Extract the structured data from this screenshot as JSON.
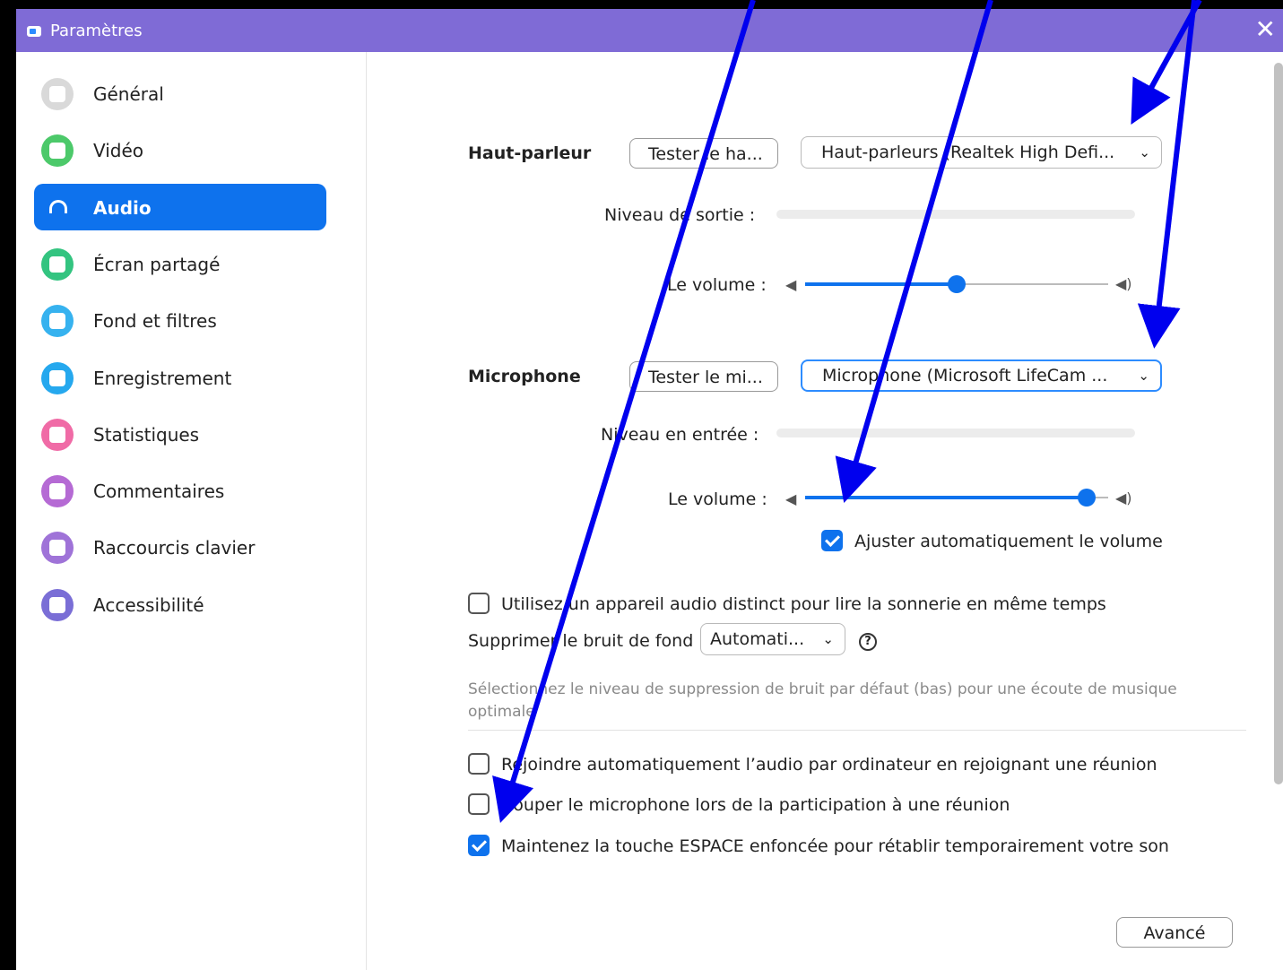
{
  "window": {
    "title": "Paramètres",
    "close": "✕"
  },
  "sidebar": {
    "items": [
      {
        "label": "Général",
        "icon": "gear-icon",
        "color": "#d9d9d9",
        "active": false
      },
      {
        "label": "Vidéo",
        "icon": "video-camera-icon",
        "color": "#4cc96a",
        "active": false
      },
      {
        "label": "Audio",
        "icon": "headphones-icon",
        "color": "#0e72ed",
        "active": true
      },
      {
        "label": "Écran partagé",
        "icon": "share-screen-icon",
        "color": "#33c480",
        "active": false
      },
      {
        "label": "Fond et filtres",
        "icon": "background-filter-icon",
        "color": "#36b2ef",
        "active": false
      },
      {
        "label": "Enregistrement",
        "icon": "record-icon",
        "color": "#25a8ee",
        "active": false
      },
      {
        "label": "Statistiques",
        "icon": "statistics-icon",
        "color": "#f06ba6",
        "active": false
      },
      {
        "label": "Commentaires",
        "icon": "feedback-icon",
        "color": "#b56ad4",
        "active": false
      },
      {
        "label": "Raccourcis clavier",
        "icon": "keyboard-icon",
        "color": "#9f73d8",
        "active": false
      },
      {
        "label": "Accessibilité",
        "icon": "accessibility-icon",
        "color": "#7a6ed6",
        "active": false
      }
    ]
  },
  "speaker": {
    "label": "Haut-parleur",
    "test_button": "Tester le ha...",
    "device": "Haut-parleurs (Realtek High Defi...",
    "output_level_label": "Niveau de sortie :",
    "volume_label": "Le volume :",
    "volume_fraction": 0.5
  },
  "microphone": {
    "label": "Microphone",
    "test_button": "Tester le mi...",
    "device": "Microphone (Microsoft LifeCam ...",
    "input_level_label": "Niveau en entrée :",
    "volume_label": "Le volume :",
    "volume_fraction": 0.93,
    "auto_adjust_label": "Ajuster automatiquement le volume",
    "auto_adjust_checked": true
  },
  "options": {
    "separate_ringtone_label": "Utilisez un appareil audio distinct pour lire la sonnerie en même temps",
    "separate_ringtone_checked": false,
    "noise_label": "Supprimer le bruit de fond",
    "noise_value": "Automati...",
    "help": "?",
    "noise_note": "Sélectionnez le niveau de suppression de bruit par défaut (bas) pour une écoute de musique optimale",
    "auto_join_label": "Rejoindre automatiquement l’audio par ordinateur en rejoignant une réunion",
    "auto_join_checked": false,
    "mute_label": "Couper le microphone lors de la participation à une réunion",
    "mute_checked": false,
    "space_label": "Maintenez la touche ESPACE enfoncée pour rétablir temporairement votre son",
    "space_checked": true
  },
  "advanced_button": "Avancé",
  "colors": {
    "titlebar": "#7f6bd6",
    "accent": "#0e72ed",
    "annotation_arrow": "#0000ee"
  }
}
